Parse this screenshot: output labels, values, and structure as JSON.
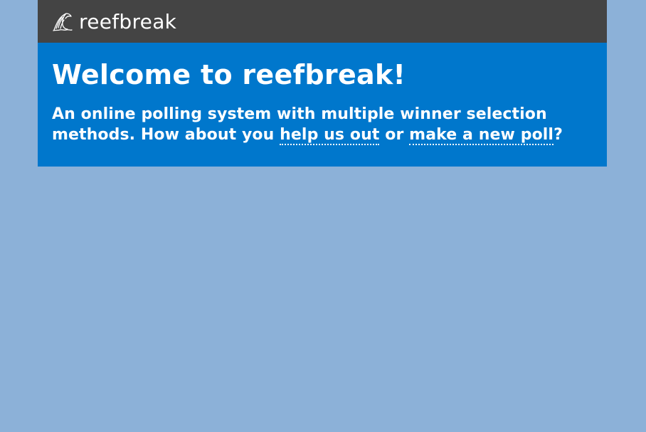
{
  "navbar": {
    "brand_name": "reefbreak",
    "logo_icon": "wave-icon"
  },
  "hero": {
    "title": "Welcome to reefbreak!",
    "text_before": "An online polling system with multiple winner selection methods. How about you ",
    "link_help": "help us out",
    "text_middle": " or ",
    "link_new_poll": "make a new poll",
    "text_after": "?"
  },
  "colors": {
    "page_background": "#8cb1d8",
    "navbar_background": "#444444",
    "hero_background": "#0077cc",
    "text": "#ffffff"
  }
}
